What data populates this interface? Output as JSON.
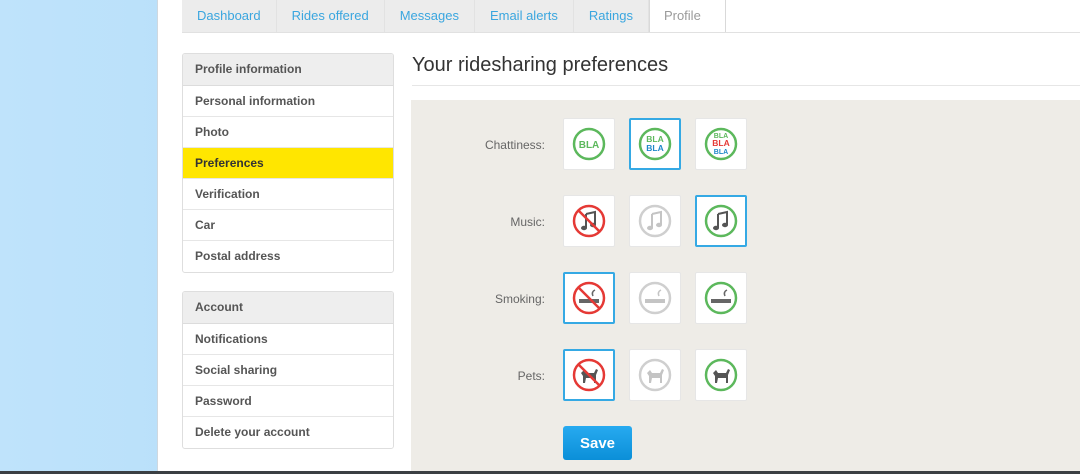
{
  "tabs": [
    "Dashboard",
    "Rides offered",
    "Messages",
    "Email alerts",
    "Ratings",
    "Profile"
  ],
  "active_tab": "Profile",
  "sidebar": {
    "profile": {
      "heading": "Profile information",
      "items": [
        "Personal information",
        "Photo",
        "Preferences",
        "Verification",
        "Car",
        "Postal address"
      ],
      "active": "Preferences"
    },
    "account": {
      "heading": "Account",
      "items": [
        "Notifications",
        "Social sharing",
        "Password",
        "Delete your account"
      ]
    }
  },
  "main": {
    "title": "Your ridesharing preferences",
    "preferences": [
      {
        "label": "Chattiness:",
        "options": [
          {
            "icon": "bla-icon",
            "text": "BLA",
            "selected": false
          },
          {
            "icon": "bla-bla-icon",
            "text": "BLA BLA",
            "selected": true
          },
          {
            "icon": "bla-bla-bla-icon",
            "text": "BLA BLA BLA",
            "selected": false
          }
        ]
      },
      {
        "label": "Music:",
        "options": [
          {
            "icon": "no-music-icon",
            "selected": false
          },
          {
            "icon": "music-maybe-icon",
            "selected": false
          },
          {
            "icon": "music-icon",
            "selected": true
          }
        ]
      },
      {
        "label": "Smoking:",
        "options": [
          {
            "icon": "no-smoking-icon",
            "selected": true
          },
          {
            "icon": "smoking-maybe-icon",
            "selected": false
          },
          {
            "icon": "smoking-icon",
            "selected": false
          }
        ]
      },
      {
        "label": "Pets:",
        "options": [
          {
            "icon": "no-pets-icon",
            "selected": true
          },
          {
            "icon": "pets-maybe-icon",
            "selected": false
          },
          {
            "icon": "pets-icon",
            "selected": false
          }
        ]
      }
    ],
    "save_label": "Save"
  },
  "colors": {
    "highlight": "#ffe600",
    "link": "#3aa6df",
    "select_border": "#35a9e4",
    "no": "#e53935",
    "maybe": "#cfcfcf",
    "yes": "#5cb85c",
    "save": "#1a9de6",
    "panel": "#eeece7",
    "background": "#a8d8f8"
  }
}
